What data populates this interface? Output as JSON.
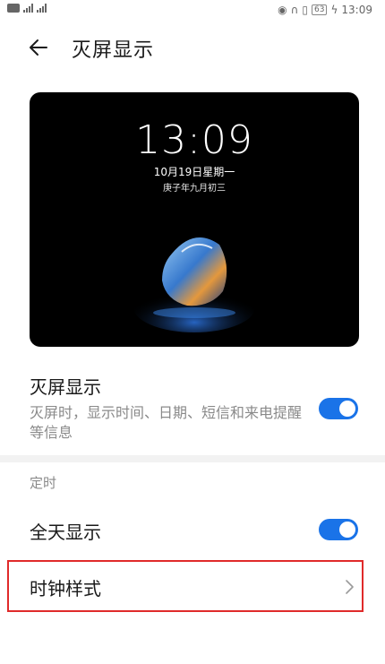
{
  "status_bar": {
    "battery": "63",
    "time": "13:09"
  },
  "header": {
    "title": "灭屏显示"
  },
  "preview": {
    "time": "13:09",
    "date": "10月19日星期一",
    "lunar": "庚子年九月初三"
  },
  "settings": {
    "aod": {
      "title": "灭屏显示",
      "description": "灭屏时，显示时间、日期、短信和来电提醒等信息",
      "enabled": true
    },
    "section_label": "定时",
    "all_day": {
      "label": "全天显示",
      "enabled": true
    },
    "clock_style": {
      "label": "时钟样式"
    }
  },
  "colors": {
    "toggle_on": "#1a73e8",
    "highlight_border": "#e02a2a"
  }
}
